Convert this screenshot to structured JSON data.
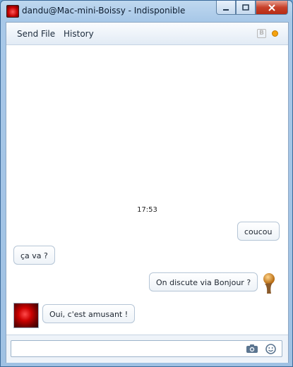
{
  "window": {
    "title": "dandu@Mac-mini-Boissy - Indisponible"
  },
  "toolbar": {
    "send_file": "Send File",
    "history": "History",
    "status_color": "#f4a20f"
  },
  "chat": {
    "timestamp": "17:53",
    "messages": [
      {
        "from": "me",
        "text": "coucou"
      },
      {
        "from": "them",
        "text": "ça va ?"
      },
      {
        "from": "me",
        "text": "On discute via Bonjour ?"
      },
      {
        "from": "them",
        "text": "Oui, c'est amusant !"
      }
    ]
  },
  "input": {
    "placeholder": ""
  }
}
